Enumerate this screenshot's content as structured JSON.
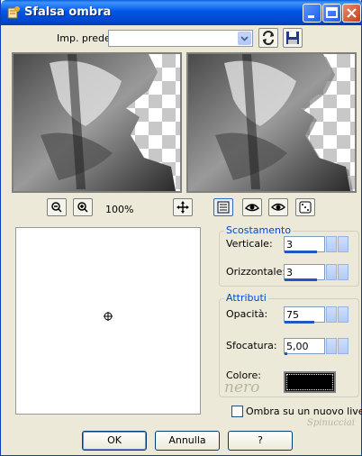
{
  "window": {
    "title": "Sfalsa ombra"
  },
  "preset": {
    "label": "Imp. predef.:",
    "value": ""
  },
  "zoom": {
    "level": "100%"
  },
  "offset": {
    "legend": "Scostamento",
    "vertical_label": "Verticale:",
    "vertical_value": "3",
    "horizontal_label": "Orizzontale:",
    "horizontal_value": "3"
  },
  "attributes": {
    "legend": "Attributi",
    "opacity_label": "Opacità:",
    "opacity_value": "75",
    "blur_label": "Sfocatura:",
    "blur_value": "5,00",
    "color_label": "Colore:",
    "color_value": "#000000"
  },
  "watermark": {
    "nero": "nero",
    "signature": "Spinucciai"
  },
  "new_layer_checkbox": {
    "label": "Ombra su un nuovo livello",
    "checked": false
  },
  "buttons": {
    "ok": "OK",
    "cancel": "Annulla",
    "help": "?"
  }
}
